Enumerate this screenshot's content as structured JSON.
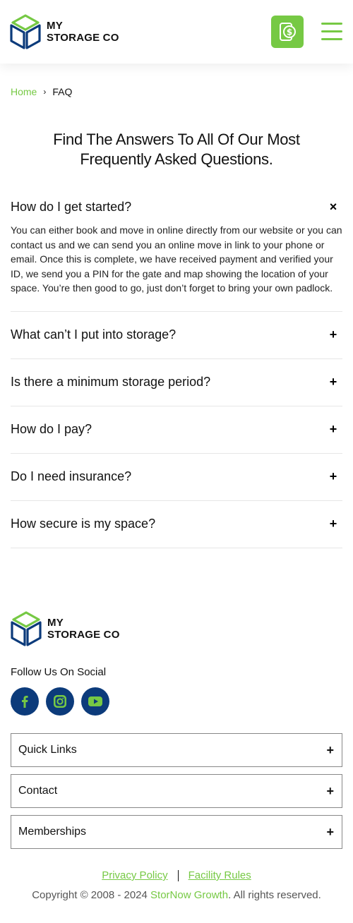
{
  "header": {
    "logo_line1": "MY",
    "logo_line2": "STORAGE CO"
  },
  "breadcrumb": {
    "home": "Home",
    "separator": "›",
    "current": "FAQ"
  },
  "page": {
    "title": "Find The Answers To All Of Our Most Frequently Asked Questions."
  },
  "faq": [
    {
      "question": "How do I get started?",
      "answer": "You can either book and move in online directly from our website or you can contact us and we can send you an online move in link to your phone or email. Once this is complete, we have received payment and verified your ID, we send you a PIN for the gate and map showing the location of your space. You’re then good to go, just don’t forget to bring your own padlock.",
      "toggle": "×"
    },
    {
      "question": "What can’t I put into storage?",
      "toggle": "+"
    },
    {
      "question": "Is there a minimum storage period?",
      "toggle": "+"
    },
    {
      "question": "How do I pay?",
      "toggle": "+"
    },
    {
      "question": "Do I need insurance?",
      "toggle": "+"
    },
    {
      "question": "How secure is my space?",
      "toggle": "+"
    }
  ],
  "footer": {
    "logo_line1": "MY",
    "logo_line2": "STORAGE CO",
    "follow": "Follow Us On Social",
    "socials": [
      "facebook-icon",
      "instagram-icon",
      "youtube-icon"
    ],
    "accordions": [
      {
        "label": "Quick Links",
        "toggle": "+"
      },
      {
        "label": "Contact",
        "toggle": "+"
      },
      {
        "label": "Memberships",
        "toggle": "+"
      }
    ],
    "privacy": "Privacy Policy",
    "facility": "Facility Rules",
    "copyright_prefix": "Copyright © 2008 - 2024 ",
    "copyright_brand": "StorNow Growth",
    "copyright_suffix": ". All rights reserved."
  },
  "colors": {
    "accent": "#76c944",
    "navy": "#0c3b7b"
  }
}
